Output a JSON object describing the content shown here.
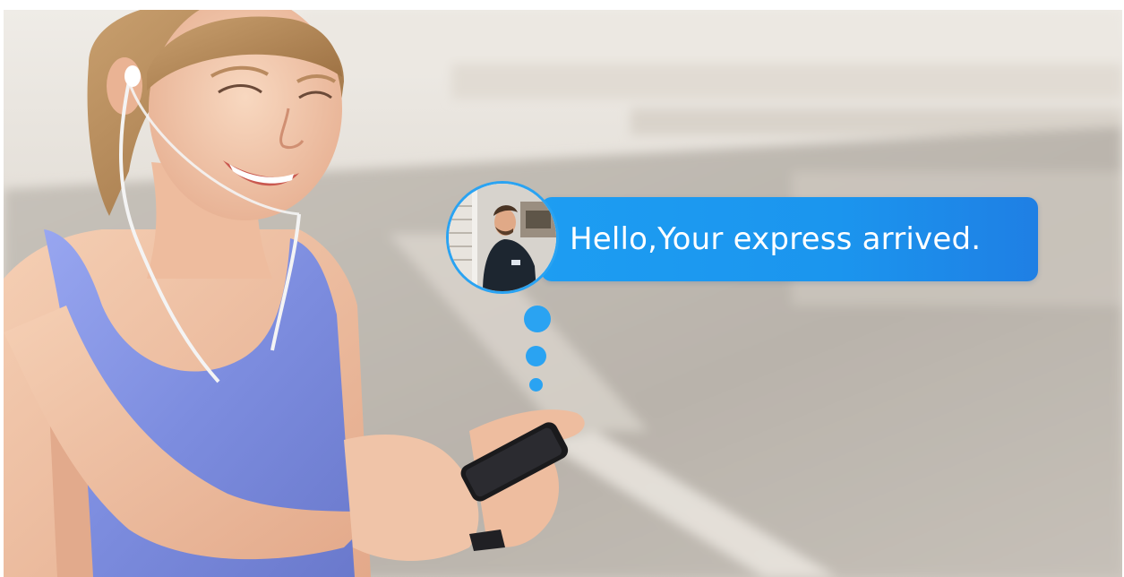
{
  "message": {
    "text": "Hello,Your express arrived."
  },
  "colors": {
    "bubble": "#1d9df2",
    "avatar_ring": "#2aa3f2",
    "tank_top": "#8a98e6",
    "sky": "#e6e2dc"
  },
  "icons": {
    "avatar": "courier-avatar",
    "typing": "typing-dots"
  }
}
